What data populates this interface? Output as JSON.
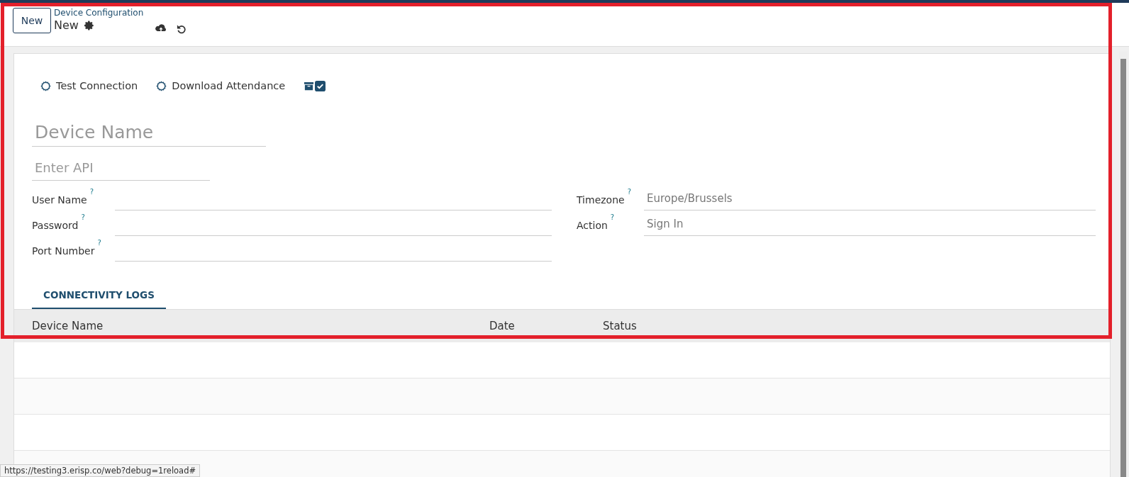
{
  "control_panel": {
    "new_button": "New",
    "breadcrumb": "Device Configuration",
    "record_title": "New"
  },
  "actions": [
    "Test Connection",
    "Download Attendance"
  ],
  "archive_toggle": {
    "checked": true
  },
  "form": {
    "device_name": {
      "placeholder": "Device Name"
    },
    "api": {
      "placeholder": "Enter API"
    },
    "left_fields": [
      {
        "label": "User Name",
        "help": "?"
      },
      {
        "label": "Password",
        "help": "?"
      },
      {
        "label": "Port Number",
        "help": "?"
      }
    ],
    "right_fields": [
      {
        "label": "Timezone",
        "help": "?",
        "value": "Europe/Brussels"
      },
      {
        "label": "Action",
        "help": "?",
        "value": "Sign In"
      }
    ]
  },
  "tabs": [
    {
      "label": "CONNECTIVITY LOGS",
      "selected": true
    }
  ],
  "table": {
    "columns": [
      "Device Name",
      "Date",
      "Status"
    ]
  },
  "status_url": "https://testing3.erisp.co/web?debug=1reload#"
}
